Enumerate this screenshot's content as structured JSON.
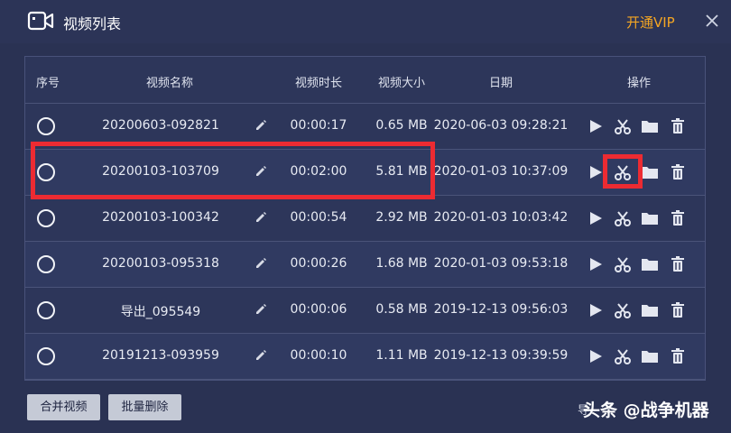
{
  "window": {
    "title": "视频列表",
    "vip_label": "开通VIP",
    "icons": {
      "app": "video-camera-icon",
      "close": "close-icon"
    }
  },
  "table": {
    "headers": [
      "序号",
      "视频名称",
      "视频时长",
      "视频大小",
      "日期",
      "操作"
    ],
    "rows": [
      {
        "name": "20200603-092821",
        "duration": "00:00:17",
        "size": "0.65 MB",
        "date": "2020-06-03 09:28:21"
      },
      {
        "name": "20200103-103709",
        "duration": "00:02:00",
        "size": "5.81 MB",
        "date": "2020-01-03 10:37:09"
      },
      {
        "name": "20200103-100342",
        "duration": "00:00:54",
        "size": "2.92 MB",
        "date": "2020-01-03 10:03:42"
      },
      {
        "name": "20200103-095318",
        "duration": "00:00:26",
        "size": "1.68 MB",
        "date": "2020-01-03 09:53:18"
      },
      {
        "name": "导出_095549",
        "duration": "00:00:06",
        "size": "0.58 MB",
        "date": "2019-12-13 09:56:03"
      },
      {
        "name": "20191213-093959",
        "duration": "00:00:10",
        "size": "1.11 MB",
        "date": "2019-12-13 09:39:59"
      }
    ],
    "row_icons": [
      "radio-icon",
      "pencil-icon",
      "play-icon",
      "scissors-icon",
      "folder-icon",
      "trash-icon"
    ]
  },
  "footer": {
    "merge_label": "合并视频",
    "batch_delete_label": "批量删除",
    "partial_text": "导",
    "watermark": "头条 @战争机器"
  },
  "colors": {
    "background": "#2a3253",
    "vip": "#f5a623",
    "highlight": "#ec2b32",
    "button": "#c5cad6"
  }
}
